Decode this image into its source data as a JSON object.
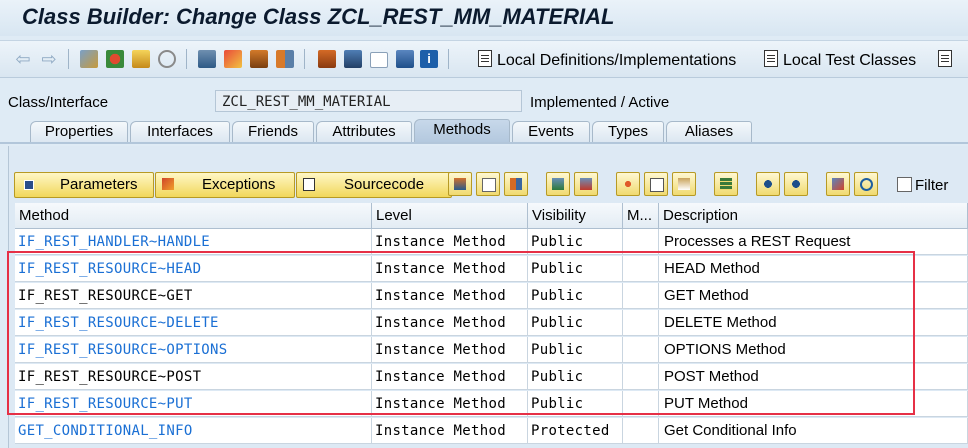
{
  "window": {
    "title": "Class Builder: Change Class ZCL_REST_MM_MATERIAL"
  },
  "toolbar": {
    "local_definitions_label": "Local Definitions/Implementations",
    "local_test_classes_label": "Local Test Classes"
  },
  "header": {
    "class_interface_label": "Class/Interface",
    "class_name": "ZCL_REST_MM_MATERIAL",
    "status": "Implemented / Active"
  },
  "tabs": [
    {
      "label": "Properties"
    },
    {
      "label": "Interfaces"
    },
    {
      "label": "Friends"
    },
    {
      "label": "Attributes"
    },
    {
      "label": "Methods"
    },
    {
      "label": "Events"
    },
    {
      "label": "Types"
    },
    {
      "label": "Aliases"
    }
  ],
  "method_toolbar": {
    "parameters_label": "Parameters",
    "exceptions_label": "Exceptions",
    "sourcecode_label": "Sourcecode",
    "filter_label": "Filter"
  },
  "grid": {
    "headers": {
      "method": "Method",
      "level": "Level",
      "visibility": "Visibility",
      "m": "M...",
      "description": "Description"
    },
    "rows": [
      {
        "method": "IF_REST_HANDLER~HANDLE",
        "level": "Instance Method",
        "visibility": "Public",
        "description": "Processes a REST Request"
      },
      {
        "method": "IF_REST_RESOURCE~HEAD",
        "level": "Instance Method",
        "visibility": "Public",
        "description": "HEAD Method"
      },
      {
        "method": "IF_REST_RESOURCE~GET",
        "level": "Instance Method",
        "visibility": "Public",
        "description": "GET Method"
      },
      {
        "method": "IF_REST_RESOURCE~DELETE",
        "level": "Instance Method",
        "visibility": "Public",
        "description": "DELETE Method"
      },
      {
        "method": "IF_REST_RESOURCE~OPTIONS",
        "level": "Instance Method",
        "visibility": "Public",
        "description": "OPTIONS Method"
      },
      {
        "method": "IF_REST_RESOURCE~POST",
        "level": "Instance Method",
        "visibility": "Public",
        "description": "POST Method"
      },
      {
        "method": "IF_REST_RESOURCE~PUT",
        "level": "Instance Method",
        "visibility": "Public",
        "description": "PUT Method"
      },
      {
        "method": "GET_CONDITIONAL_INFO",
        "level": "Instance Method",
        "visibility": "Protected",
        "description": "Get Conditional Info"
      }
    ]
  },
  "colors": {
    "link": "#1a6fd4",
    "highlight_border": "#e63046",
    "button_yellow": "#f1d75b"
  }
}
